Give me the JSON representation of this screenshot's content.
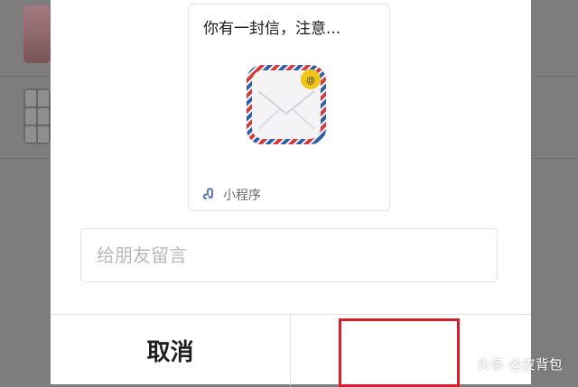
{
  "share_card": {
    "title": "你有一封信，注意...",
    "footer_label": "小程序",
    "app_icon": "airmail-envelope-icon",
    "mini_program_icon": "mini-program-link-icon"
  },
  "message_input": {
    "placeholder": "给朋友留言",
    "value": ""
  },
  "buttons": {
    "cancel_label": "取消",
    "send_label": ""
  },
  "watermark": "头条 @皮背包",
  "colors": {
    "highlight": "#d5202c",
    "overlay": "#7d7d7d",
    "dialog": "#ffffff",
    "envelope_border_red": "#d43a3a",
    "envelope_border_blue": "#2f5fa8",
    "badge": "#f2c514"
  }
}
